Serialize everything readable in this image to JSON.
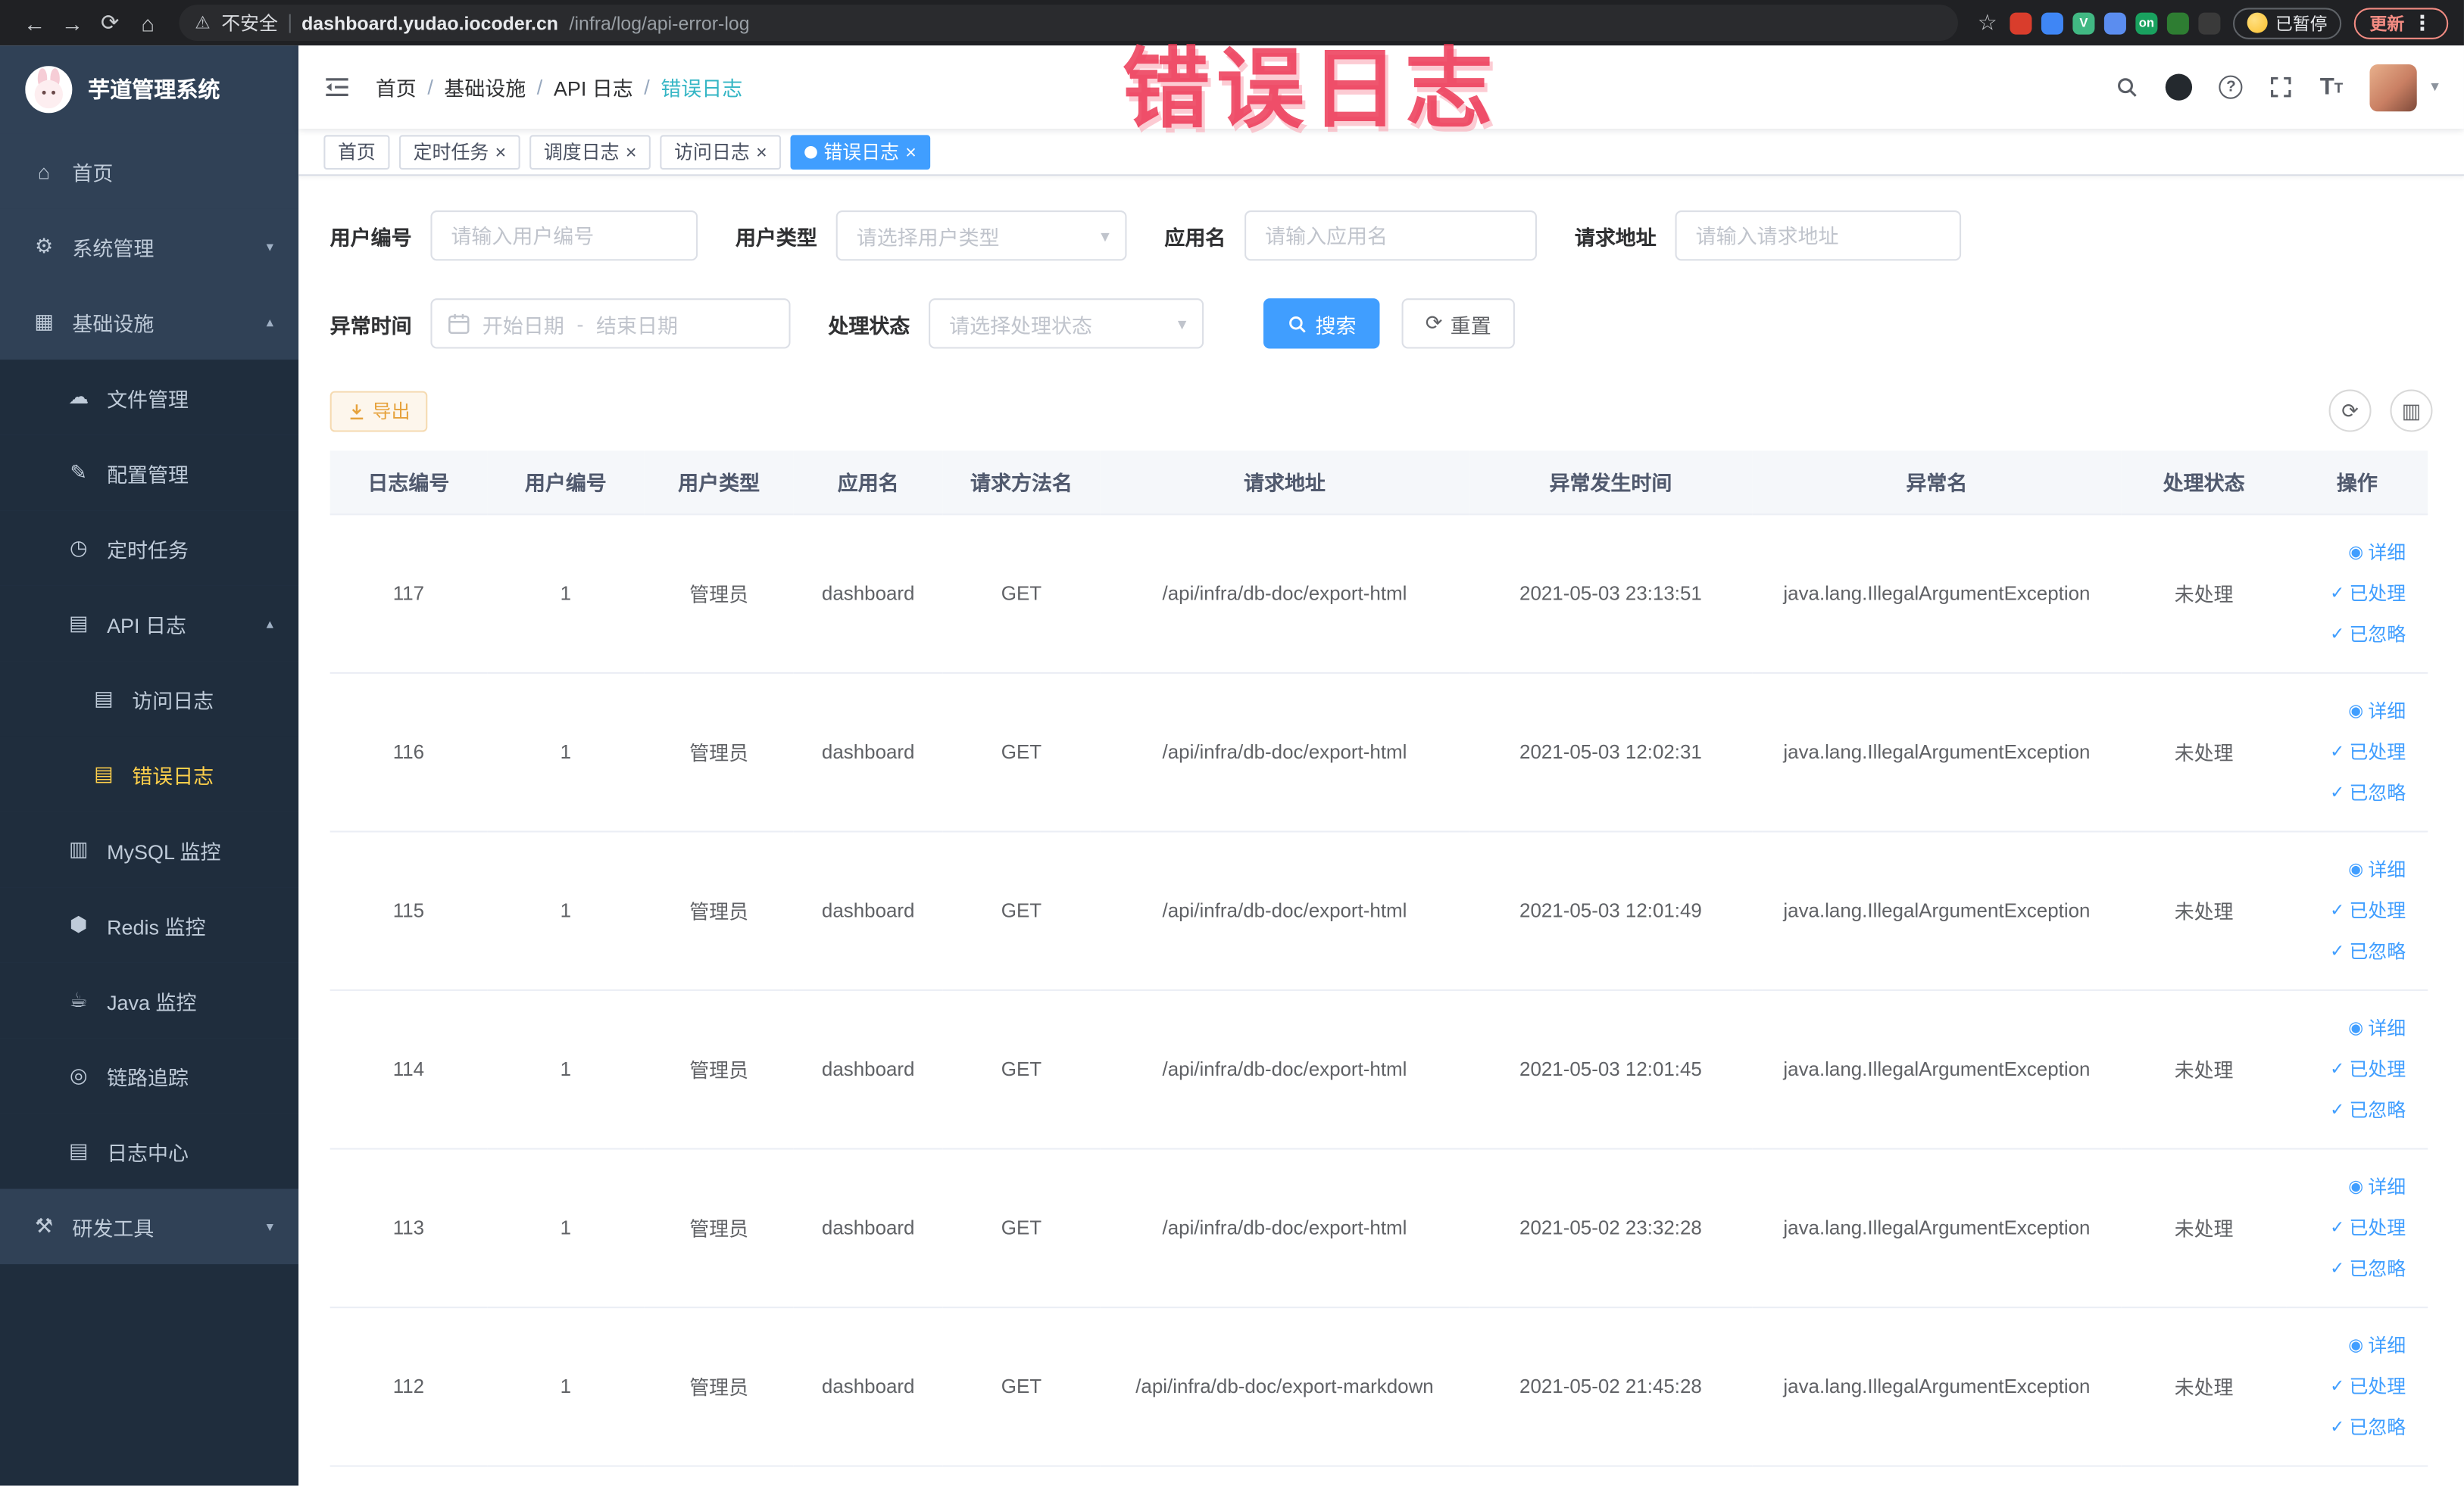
{
  "browser": {
    "security_label": "不安全",
    "url_domain": "dashboard.yudao.iocoder.cn",
    "url_path": "/infra/log/api-error-log",
    "paused_label": "已暂停",
    "update_label": "更新",
    "extensions": [
      {
        "color": "#d93d2c",
        "text": ""
      },
      {
        "color": "#3f86f5",
        "text": ""
      },
      {
        "color": "#41b883",
        "text": "V"
      },
      {
        "color": "#5b8def",
        "text": ""
      },
      {
        "color": "#19a15f",
        "text": "on"
      },
      {
        "color": "#2e7d32",
        "text": ""
      },
      {
        "color": "#3a3a3a",
        "text": ""
      }
    ]
  },
  "annotation": {
    "text": "错误日志"
  },
  "sidebar": {
    "title": "芋道管理系统",
    "items": [
      {
        "id": "home",
        "label": "首页",
        "icon": "home-icon",
        "level": 0
      },
      {
        "id": "system",
        "label": "系统管理",
        "icon": "gear-icon",
        "level": 0,
        "arrow": "down"
      },
      {
        "id": "infrastructure",
        "label": "基础设施",
        "icon": "grid-icon",
        "level": 0,
        "arrow": "up"
      },
      {
        "id": "file",
        "label": "文件管理",
        "icon": "cloud-icon",
        "level": 1
      },
      {
        "id": "config",
        "label": "配置管理",
        "icon": "edit-icon",
        "level": 1
      },
      {
        "id": "job",
        "label": "定时任务",
        "icon": "clock-icon",
        "level": 1
      },
      {
        "id": "api-log",
        "label": "API 日志",
        "icon": "doc-icon",
        "level": 1,
        "arrow": "up"
      },
      {
        "id": "access-log",
        "label": "访问日志",
        "icon": "doc-icon",
        "level": 2
      },
      {
        "id": "error-log",
        "label": "错误日志",
        "icon": "doc-icon",
        "level": 2,
        "active": true
      },
      {
        "id": "mysql",
        "label": "MySQL 监控",
        "icon": "db-icon",
        "level": 1
      },
      {
        "id": "redis",
        "label": "Redis 监控",
        "icon": "hex-icon",
        "level": 1
      },
      {
        "id": "java",
        "label": "Java 监控",
        "icon": "coffee-icon",
        "level": 1
      },
      {
        "id": "trace",
        "label": "链路追踪",
        "icon": "eye-icon",
        "level": 1
      },
      {
        "id": "log-center",
        "label": "日志中心",
        "icon": "doc-icon",
        "level": 1
      },
      {
        "id": "dev-tools",
        "label": "研发工具",
        "icon": "tools-icon",
        "level": 0,
        "arrow": "down"
      }
    ]
  },
  "breadcrumb": {
    "items": [
      "首页",
      "基础设施",
      "API 日志",
      "错误日志"
    ]
  },
  "tabs": [
    {
      "id": "home",
      "label": "首页",
      "closable": false,
      "active": false
    },
    {
      "id": "job",
      "label": "定时任务",
      "closable": true,
      "active": false
    },
    {
      "id": "job-log",
      "label": "调度日志",
      "closable": true,
      "active": false
    },
    {
      "id": "access-log",
      "label": "访问日志",
      "closable": true,
      "active": false
    },
    {
      "id": "error-log",
      "label": "错误日志",
      "closable": true,
      "active": true
    }
  ],
  "filters": {
    "user_id": {
      "label": "用户编号",
      "placeholder": "请输入用户编号"
    },
    "user_type": {
      "label": "用户类型",
      "placeholder": "请选择用户类型"
    },
    "app_name": {
      "label": "应用名",
      "placeholder": "请输入应用名"
    },
    "request_url": {
      "label": "请求地址",
      "placeholder": "请输入请求地址"
    },
    "exception_time": {
      "label": "异常时间",
      "start_placeholder": "开始日期",
      "separator": "-",
      "end_placeholder": "结束日期"
    },
    "process_status": {
      "label": "处理状态",
      "placeholder": "请选择处理状态"
    },
    "search_label": "搜索",
    "reset_label": "重置"
  },
  "toolbar": {
    "export_label": "导出"
  },
  "table": {
    "columns": [
      "日志编号",
      "用户编号",
      "用户类型",
      "应用名",
      "请求方法名",
      "请求地址",
      "异常发生时间",
      "异常名",
      "处理状态",
      "操作"
    ],
    "rows": [
      [
        "117",
        "1",
        "管理员",
        "dashboard",
        "GET",
        "/api/infra/db-doc/export-html",
        "2021-05-03 23:13:51",
        "java.lang.IllegalArgumentException",
        "未处理"
      ],
      [
        "116",
        "1",
        "管理员",
        "dashboard",
        "GET",
        "/api/infra/db-doc/export-html",
        "2021-05-03 12:02:31",
        "java.lang.IllegalArgumentException",
        "未处理"
      ],
      [
        "115",
        "1",
        "管理员",
        "dashboard",
        "GET",
        "/api/infra/db-doc/export-html",
        "2021-05-03 12:01:49",
        "java.lang.IllegalArgumentException",
        "未处理"
      ],
      [
        "114",
        "1",
        "管理员",
        "dashboard",
        "GET",
        "/api/infra/db-doc/export-html",
        "2021-05-03 12:01:45",
        "java.lang.IllegalArgumentException",
        "未处理"
      ],
      [
        "113",
        "1",
        "管理员",
        "dashboard",
        "GET",
        "/api/infra/db-doc/export-html",
        "2021-05-02 23:32:28",
        "java.lang.IllegalArgumentException",
        "未处理"
      ],
      [
        "112",
        "1",
        "管理员",
        "dashboard",
        "GET",
        "/api/infra/db-doc/export-markdown",
        "2021-05-02 21:45:28",
        "java.lang.IllegalArgumentException",
        "未处理"
      ]
    ],
    "row_actions": [
      {
        "id": "detail",
        "icon": "view-icon",
        "label": "详细"
      },
      {
        "id": "processed",
        "icon": "check-icon",
        "label": "已处理"
      },
      {
        "id": "ignored",
        "icon": "check-icon",
        "label": "已忽略"
      }
    ]
  },
  "colors": {
    "accent": "#409eff",
    "sidebar_bg": "#304156",
    "submenu_bg": "#1f2d3d",
    "active_menu_text": "#ffd04b",
    "warning": "#e6a23c",
    "annotation": "#ee3a5e"
  }
}
